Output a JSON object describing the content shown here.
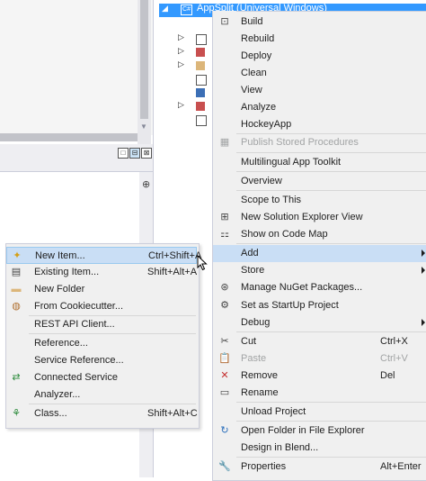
{
  "solution_explorer": {
    "selected_project": "AppSplit (Universal Windows)",
    "project_icon": "csharp-project-icon"
  },
  "left_panel": {
    "buttons": [
      "□",
      "⊟",
      "⊠"
    ],
    "pin_glyph": "⊕"
  },
  "context_menu": {
    "items": [
      {
        "label": "Build",
        "shortcut": "",
        "icon": "build-icon",
        "glyph": "⊡"
      },
      {
        "label": "Rebuild",
        "shortcut": "",
        "icon": "",
        "glyph": ""
      },
      {
        "label": "Deploy",
        "shortcut": "",
        "icon": "",
        "glyph": ""
      },
      {
        "label": "Clean",
        "shortcut": "",
        "icon": "",
        "glyph": ""
      },
      {
        "label": "View",
        "shortcut": "",
        "icon": "",
        "glyph": ""
      },
      {
        "label": "Analyze",
        "shortcut": "",
        "icon": "",
        "glyph": ""
      },
      {
        "label": "HockeyApp",
        "shortcut": "",
        "icon": "",
        "glyph": ""
      },
      {
        "label": "Publish Stored Procedures",
        "shortcut": "",
        "icon": "publish-icon",
        "glyph": "▦",
        "disabled": true
      },
      {
        "label": "Multilingual App Toolkit",
        "shortcut": "",
        "icon": "",
        "glyph": ""
      },
      {
        "label": "Overview",
        "shortcut": "",
        "icon": "",
        "glyph": ""
      },
      {
        "label": "Scope to This",
        "shortcut": "",
        "icon": "",
        "glyph": ""
      },
      {
        "label": "New Solution Explorer View",
        "shortcut": "",
        "icon": "new-view-icon",
        "glyph": "⊞"
      },
      {
        "label": "Show on Code Map",
        "shortcut": "",
        "icon": "code-map-icon",
        "glyph": "⚏"
      },
      {
        "label": "Add",
        "shortcut": "",
        "icon": "",
        "glyph": ""
      },
      {
        "label": "Store",
        "shortcut": "",
        "icon": "",
        "glyph": ""
      },
      {
        "label": "Manage NuGet Packages...",
        "shortcut": "",
        "icon": "nuget-icon",
        "glyph": "⊛"
      },
      {
        "label": "Set as StartUp Project",
        "shortcut": "",
        "icon": "gear-icon",
        "glyph": "⚙"
      },
      {
        "label": "Debug",
        "shortcut": "",
        "icon": "",
        "glyph": ""
      },
      {
        "label": "Cut",
        "shortcut": "Ctrl+X",
        "icon": "cut-icon",
        "glyph": "✂"
      },
      {
        "label": "Paste",
        "shortcut": "Ctrl+V",
        "icon": "paste-icon",
        "glyph": "📋",
        "disabled": true
      },
      {
        "label": "Remove",
        "shortcut": "Del",
        "icon": "remove-icon",
        "glyph": "✕"
      },
      {
        "label": "Rename",
        "shortcut": "",
        "icon": "rename-icon",
        "glyph": "▭"
      },
      {
        "label": "Unload Project",
        "shortcut": "",
        "icon": "",
        "glyph": ""
      },
      {
        "label": "Open Folder in File Explorer",
        "shortcut": "",
        "icon": "refresh-icon",
        "glyph": "↻"
      },
      {
        "label": "Design in Blend...",
        "shortcut": "",
        "icon": "",
        "glyph": ""
      },
      {
        "label": "Properties",
        "shortcut": "Alt+Enter",
        "icon": "wrench-icon",
        "glyph": "🔧"
      }
    ]
  },
  "add_submenu": {
    "items": [
      {
        "label": "New Item...",
        "shortcut": "Ctrl+Shift+A",
        "icon": "new-item-icon",
        "glyph": "✦"
      },
      {
        "label": "Existing Item...",
        "shortcut": "Shift+Alt+A",
        "icon": "existing-item-icon",
        "glyph": "▤"
      },
      {
        "label": "New Folder",
        "shortcut": "",
        "icon": "new-folder-icon",
        "glyph": "▬"
      },
      {
        "label": "From Cookiecutter...",
        "shortcut": "",
        "icon": "cookiecutter-icon",
        "glyph": "◍"
      },
      {
        "label": "REST API Client...",
        "shortcut": "",
        "icon": "",
        "glyph": ""
      },
      {
        "label": "Reference...",
        "shortcut": "",
        "icon": "",
        "glyph": ""
      },
      {
        "label": "Service Reference...",
        "shortcut": "",
        "icon": "",
        "glyph": ""
      },
      {
        "label": "Connected Service",
        "shortcut": "",
        "icon": "connected-service-icon",
        "glyph": "⇄"
      },
      {
        "label": "Analyzer...",
        "shortcut": "",
        "icon": "",
        "glyph": ""
      },
      {
        "label": "Class...",
        "shortcut": "Shift+Alt+C",
        "icon": "class-icon",
        "glyph": "⚘"
      }
    ]
  }
}
